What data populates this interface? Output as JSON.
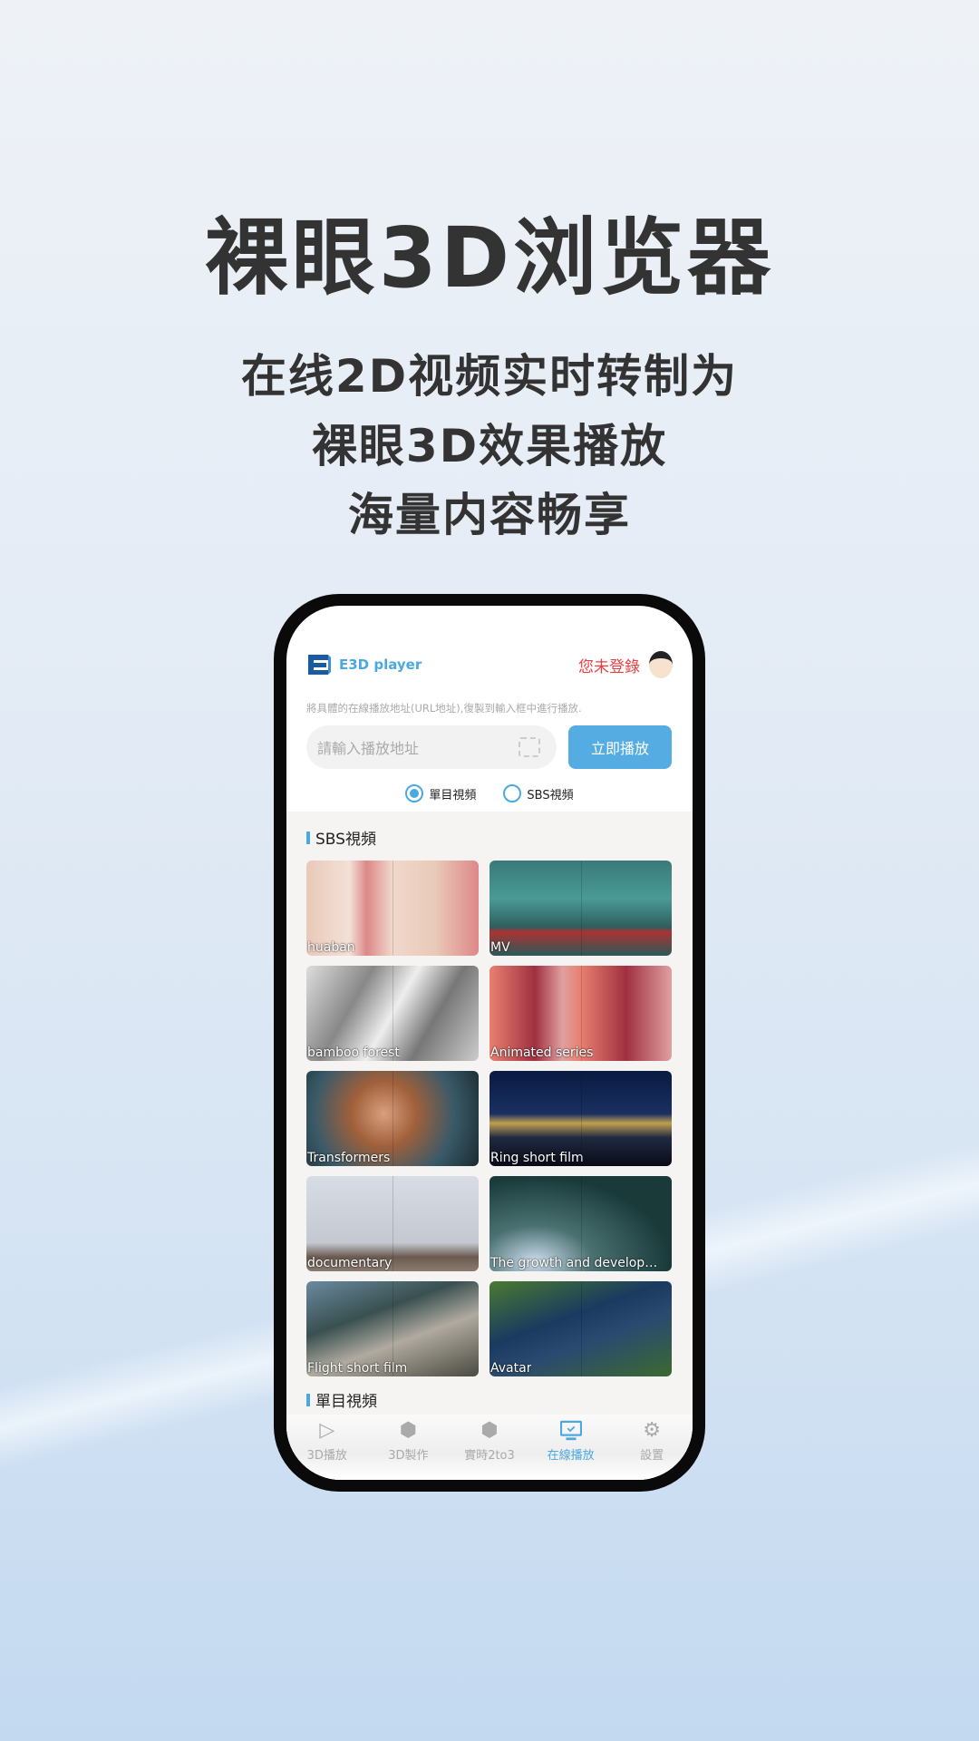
{
  "promo": {
    "title": "裸眼3D浏览器",
    "lines": [
      "在线2D视频实时转制为",
      "裸眼3D效果播放",
      "海量内容畅享"
    ]
  },
  "app": {
    "name": "E3D player",
    "login": "您未登錄",
    "hint": "將具體的在線播放地址(URL地址),復製到輸入框中進行播放.",
    "input_placeholder": "請輸入播放地址",
    "play_button": "立即播放",
    "radios": [
      {
        "label": "單目視頻",
        "selected": true
      },
      {
        "label": "SBS視頻",
        "selected": false
      }
    ],
    "section_sbs": "SBS視頻",
    "section_mono": "單目視頻",
    "videos": [
      "huaban",
      "MV",
      "bamboo forest",
      "Animated series",
      "Transformers",
      "Ring short film",
      "documentary",
      "The growth and developm...",
      "Flight short film",
      "Avatar"
    ],
    "tabs": [
      {
        "label": "3D播放",
        "icon": "play-icon"
      },
      {
        "label": "3D製作",
        "icon": "cube-icon"
      },
      {
        "label": "實時2to3",
        "icon": "cube-eye-icon"
      },
      {
        "label": "在線播放",
        "icon": "monitor-check-icon",
        "active": true
      },
      {
        "label": "設置",
        "icon": "gear-icon"
      }
    ]
  },
  "colors": {
    "accent": "#55ace2",
    "login": "#e84040"
  }
}
